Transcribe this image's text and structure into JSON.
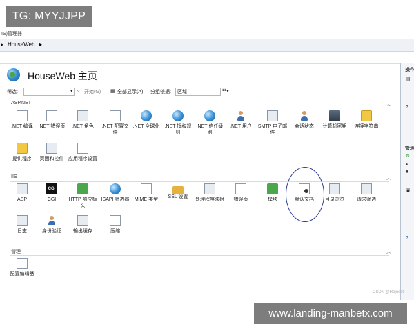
{
  "overlay": {
    "tg_label": "TG: MYYJJPP",
    "url_label": "www.landing-manbetx.com"
  },
  "app": {
    "title_fragment": "IS)管理器"
  },
  "address_bar": {
    "crumb": "HouseWeb"
  },
  "page": {
    "title": "HouseWeb 主页"
  },
  "filter_bar": {
    "filter_label": "筛选:",
    "start_label": "开始(G)",
    "show_all_label": "全部显示(A)",
    "group_label": "分组依据:",
    "group_value": "区域"
  },
  "sections": [
    {
      "name": "ASP.NET",
      "items": [
        {
          "label": ".NET 编译",
          "icon": "compile-icon"
        },
        {
          "label": ".NET 错误页",
          "icon": "error-page-icon"
        },
        {
          "label": ".NET 角色",
          "icon": "roles-icon"
        },
        {
          "label": ".NET 配置文件",
          "icon": "profile-icon"
        },
        {
          "label": ".NET 全球化",
          "icon": "globe-icon"
        },
        {
          "label": ".NET 授权规则",
          "icon": "authorization-icon"
        },
        {
          "label": ".NET 信任级别",
          "icon": "trust-icon"
        },
        {
          "label": ".NET 用户",
          "icon": "users-icon"
        },
        {
          "label": "SMTP 电子邮件",
          "icon": "smtp-icon"
        },
        {
          "label": "会话状态",
          "icon": "session-icon"
        },
        {
          "label": "计算机密钥",
          "icon": "machine-key-icon"
        },
        {
          "label": "连接字符串",
          "icon": "connection-string-icon"
        },
        {
          "label": "提供程序",
          "icon": "providers-icon"
        },
        {
          "label": "页面和控件",
          "icon": "pages-controls-icon"
        },
        {
          "label": "应用程序设置",
          "icon": "app-settings-icon"
        }
      ]
    },
    {
      "name": "IIS",
      "items": [
        {
          "label": "ASP",
          "icon": "asp-icon"
        },
        {
          "label": "CGI",
          "icon": "cgi-icon"
        },
        {
          "label": "HTTP 响应标头",
          "icon": "http-headers-icon"
        },
        {
          "label": "ISAPI 筛选器",
          "icon": "isapi-icon"
        },
        {
          "label": "MIME 类型",
          "icon": "mime-icon"
        },
        {
          "label": "SSL 设置",
          "icon": "lock-icon"
        },
        {
          "label": "处理程序映射",
          "icon": "handler-icon"
        },
        {
          "label": "错误页",
          "icon": "error-icon"
        },
        {
          "label": "模块",
          "icon": "modules-icon"
        },
        {
          "label": "默认文档",
          "icon": "default-document-icon"
        },
        {
          "label": "目录浏览",
          "icon": "directory-browse-icon"
        },
        {
          "label": "请求筛选",
          "icon": "request-filter-icon"
        },
        {
          "label": "日志",
          "icon": "logging-icon"
        },
        {
          "label": "身份验证",
          "icon": "authentication-icon"
        },
        {
          "label": "输出缓存",
          "icon": "output-cache-icon"
        },
        {
          "label": "压缩",
          "icon": "compression-icon"
        }
      ]
    },
    {
      "name": "管理",
      "items": [
        {
          "label": "配置编辑器",
          "icon": "config-editor-icon"
        }
      ]
    }
  ],
  "right_panel": {
    "header1": "操作",
    "header2": "管理"
  },
  "watermark": "CSDN @Rejoest"
}
